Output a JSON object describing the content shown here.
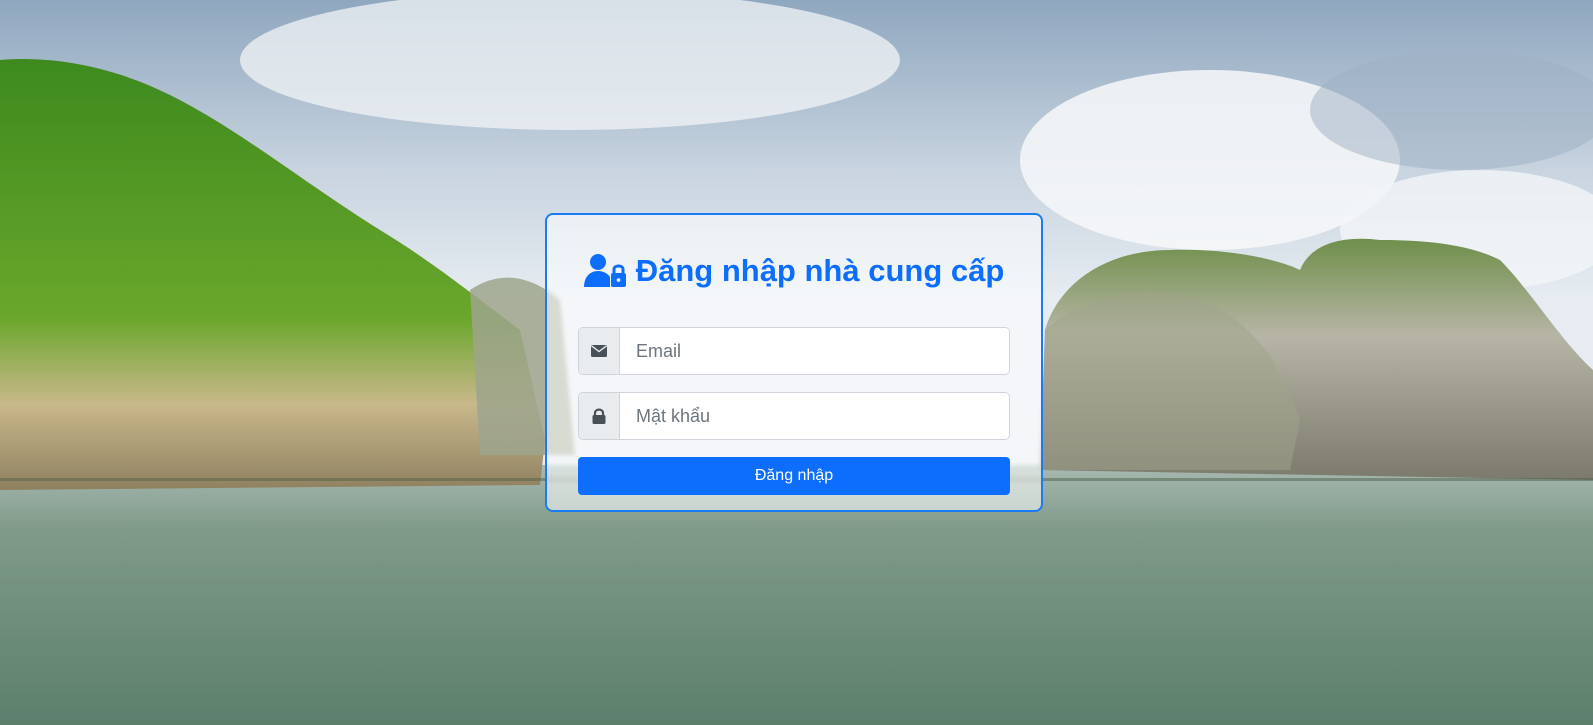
{
  "login": {
    "title": "Đăng nhập nhà cung cấp",
    "title_icon": "user-lock-icon",
    "email": {
      "icon": "envelope-icon",
      "placeholder": "Email",
      "value": ""
    },
    "password": {
      "icon": "lock-icon",
      "placeholder": "Mật khẩu",
      "value": ""
    },
    "submit_label": "Đăng nhập"
  },
  "colors": {
    "accent": "#0d6efd",
    "card_border": "#1a7cf5"
  }
}
